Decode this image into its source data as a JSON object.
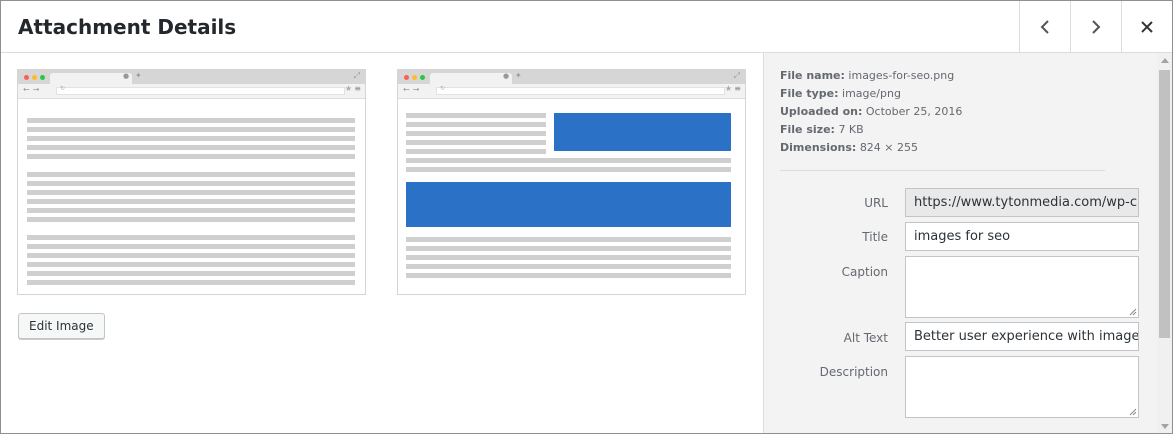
{
  "header": {
    "title": "Attachment Details"
  },
  "icons": {
    "prev": "chevron-left-icon",
    "next": "chevron-right-icon",
    "close": "close-icon"
  },
  "media": {
    "edit_button": "Edit Image",
    "accent_color": "#2b72c7"
  },
  "details": {
    "file_name_label": "File name:",
    "file_name": "images-for-seo.png",
    "file_type_label": "File type:",
    "file_type": "image/png",
    "uploaded_label": "Uploaded on:",
    "uploaded": "October 25, 2016",
    "size_label": "File size:",
    "size": "7 KB",
    "dimensions_label": "Dimensions:",
    "dimensions": "824 × 255"
  },
  "fields": {
    "url_label": "URL",
    "url_value": "https://www.tytonmedia.com/wp-c",
    "title_label": "Title",
    "title_value": "images for seo",
    "caption_label": "Caption",
    "caption_value": "",
    "alt_label": "Alt Text",
    "alt_value": "Better user experience with images",
    "description_label": "Description",
    "description_value": ""
  }
}
